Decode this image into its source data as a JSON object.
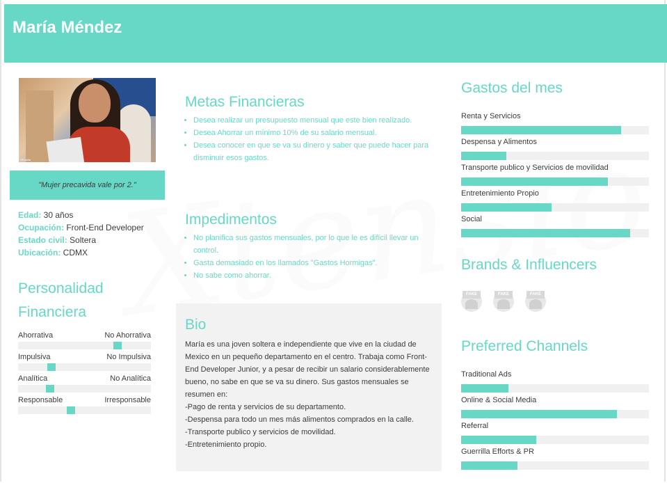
{
  "persona": {
    "name": "María Méndez",
    "quote": "\"Mujer precavida vale por 2.\"",
    "facts": [
      {
        "label": "Edad:",
        "value": " 30 años"
      },
      {
        "label": "Ocupación:",
        "value": " Front-End Developer"
      },
      {
        "label": "Estado civil:",
        "value": " Soltera"
      },
      {
        "label": "Ubicación:",
        "value": " CDMX"
      }
    ],
    "photo_credit": "©Fotolia"
  },
  "personalidad": {
    "title_line1": "Personalidad",
    "title_line2": "Financiera",
    "sliders": [
      {
        "left": "Ahorrativa",
        "right": "No Ahorrativa",
        "position": 0.75
      },
      {
        "left": "Impulsiva",
        "right": "No Impulsiva",
        "position": 0.25
      },
      {
        "left": "Analítica",
        "right": "No Analítica",
        "position": 0.24
      },
      {
        "left": "Responsable",
        "right": "Irresponsable",
        "position": 0.4
      }
    ]
  },
  "metas": {
    "title": "Metas Financieras",
    "items": [
      "Desea realizar un presupuesto mensual que este bien realizado.",
      "Desea Ahorrar un mínimo 10% de su salario mensual.",
      "Desea conocer en que se va su dinero y saber que puede hacer para disminuir esos gastos."
    ]
  },
  "impedimentos": {
    "title": "Impedimentos",
    "items": [
      "No planifica sus gastos mensuales, por lo que le es difícil llevar un control.",
      "Gasta demasiado en los llamados \"Gastos Hormigas\".",
      "No sabe como ahorrar."
    ]
  },
  "bio": {
    "title": "Bio",
    "text": "María es una joven soltera e independiente que vive en la ciudad de Mexico en un pequeño departamento en el centro. Trabaja como Front-End Developer Junior, y a pesar de recibir un salario considerablemente bueno, no sabe en que se va su dinero. Sus gastos mensuales se resumen en:\n-Pago de renta y servicios de su departamento.\n-Despensa para todo un mes más alimentos comprados en la calle.\n-Transporte publico y servicios de movilidad.\n-Entretenimiento propio."
  },
  "gastos": {
    "title": "Gastos del mes",
    "bars": [
      {
        "label": "Renta y Servicios",
        "value": 0.85
      },
      {
        "label": "Despensa y Alimentos",
        "value": 0.24
      },
      {
        "label": "Transporte publico y Servicios de movilidad",
        "value": 0.78
      },
      {
        "label": "Entretenimiento Propio",
        "value": 0.48
      },
      {
        "label": "Social",
        "value": 0.9
      }
    ]
  },
  "brands": {
    "title": "Brands & Influencers",
    "logos": [
      {
        "icon": "fake-brand-logo-1",
        "text": "FAKE"
      },
      {
        "icon": "fake-brand-logo-2",
        "text": "FAKE"
      },
      {
        "icon": "fake-brand-logo-3",
        "text": "FAKE"
      }
    ]
  },
  "channels": {
    "title": "Preferred Channels",
    "bars": [
      {
        "label": "Traditional Ads",
        "value": 0.25
      },
      {
        "label": "Online & Social Media",
        "value": 0.83
      },
      {
        "label": "Referral",
        "value": 0.4
      },
      {
        "label": "Guerrilla Efforts & PR",
        "value": 0.3
      }
    ]
  },
  "watermark": "Xtensio",
  "colors": {
    "accent": "#67d8c6",
    "panel": "#f2f2f2",
    "track": "#f0f0f0"
  }
}
